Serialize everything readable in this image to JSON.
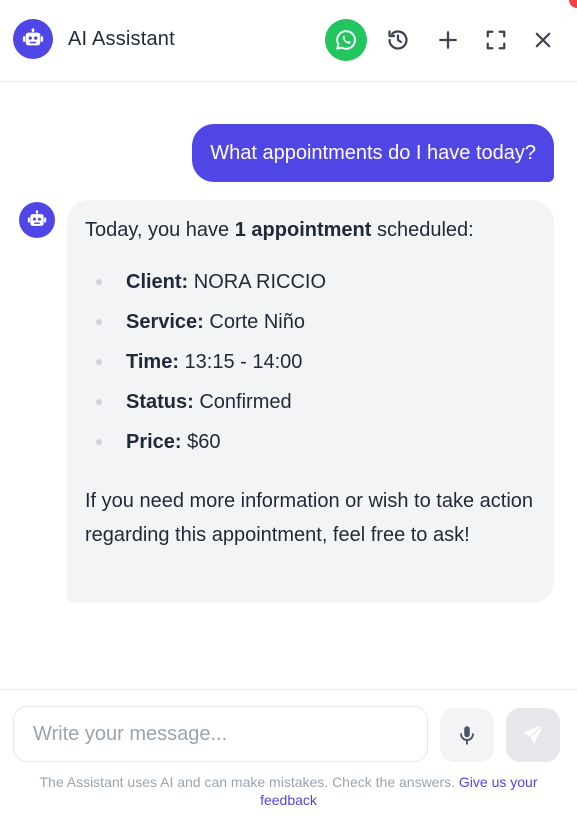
{
  "header": {
    "title": "AI Assistant",
    "icons": [
      "robot-icon",
      "whatsapp-icon",
      "history-icon",
      "plus-icon",
      "fullscreen-icon",
      "close-icon"
    ]
  },
  "colors": {
    "brand": "#4f46e5",
    "whatsapp": "#22c55e",
    "bubble_bg": "#f3f4f6"
  },
  "messages": {
    "user": "What appointments do I have today?",
    "bot": {
      "intro_pre": "Today, you have ",
      "intro_bold": "1 appointment",
      "intro_post": " scheduled:",
      "items": [
        {
          "label": "Client:",
          "value": " NORA RICCIO"
        },
        {
          "label": "Service:",
          "value": " Corte Niño"
        },
        {
          "label": "Time:",
          "value": " 13:15 - 14:00"
        },
        {
          "label": "Status:",
          "value": " Confirmed"
        },
        {
          "label": "Price:",
          "value": " $60"
        }
      ],
      "outro": "If you need more information or wish to take action regarding this appointment, feel free to ask!"
    }
  },
  "composer": {
    "placeholder": "Write your message...",
    "value": "",
    "disclaimer": "The Assistant uses AI and can make mistakes. Check the answers.",
    "feedback_link": "Give us your feedback"
  }
}
